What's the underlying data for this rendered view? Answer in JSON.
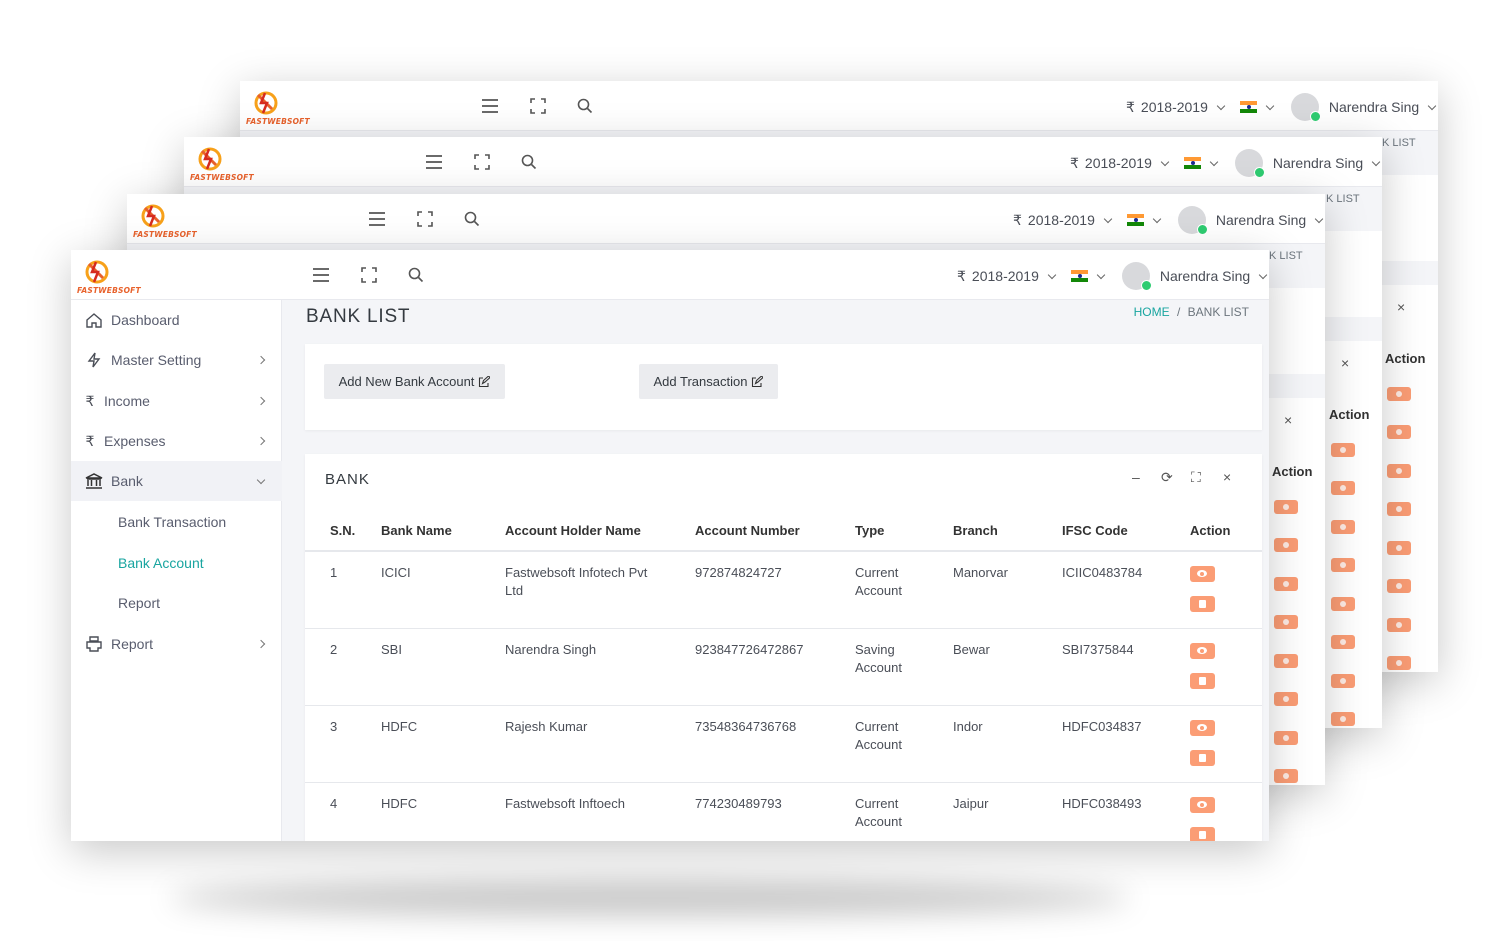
{
  "brand": {
    "logo_text": "FASTWEBSOFT"
  },
  "topbar": {
    "menu_icon": "hamburger-icon",
    "fullscreen_icon": "fullscreen-icon",
    "search_icon": "search-icon",
    "currency_symbol": "₹",
    "financial_year": "2018-2019",
    "language_flag": "india-flag-icon",
    "user_name": "Narendra Sing"
  },
  "sidebar": {
    "items": [
      {
        "label": "Dashboard",
        "icon": "home-icon"
      },
      {
        "label": "Master Setting",
        "icon": "bolt-icon"
      },
      {
        "label": "Income",
        "icon": "rupee-icon",
        "icon_glyph": "₹"
      },
      {
        "label": "Expenses",
        "icon": "rupee-icon",
        "icon_glyph": "₹"
      },
      {
        "label": "Bank",
        "icon": "bank-icon"
      },
      {
        "label": "Report",
        "icon": "printer-icon"
      }
    ],
    "bank_sub": [
      {
        "label": "Bank Transaction"
      },
      {
        "label": "Bank Account"
      },
      {
        "label": "Report"
      }
    ]
  },
  "page": {
    "title": "BANK LIST",
    "breadcrumb_home": "HOME",
    "breadcrumb_sep": "/",
    "breadcrumb_current": "BANK LIST",
    "back_breadcrumb_fragment": "K LIST"
  },
  "actions": {
    "add_bank": "Add New Bank Account",
    "add_transaction": "Add Transaction"
  },
  "bank_card": {
    "title": "BANK",
    "tools": {
      "minimize": "–",
      "refresh": "⟳",
      "expand": "⛶",
      "close": "×"
    },
    "columns": [
      "S.N.",
      "Bank Name",
      "Account Holder Name",
      "Account Number",
      "Type",
      "Branch",
      "IFSC Code",
      "Action"
    ],
    "rows": [
      {
        "sn": "1",
        "bank": "ICICI",
        "holder": "Fastwebsoft Infotech Pvt Ltd",
        "account": "972874824727",
        "type": "Current Account",
        "branch": "Manorvar",
        "ifsc": "ICIIC0483784"
      },
      {
        "sn": "2",
        "bank": "SBI",
        "holder": "Narendra Singh",
        "account": "923847726472867",
        "type": "Saving Account",
        "branch": "Bewar",
        "ifsc": "SBI7375844"
      },
      {
        "sn": "3",
        "bank": "HDFC",
        "holder": "Rajesh Kumar",
        "account": "73548364736768",
        "type": "Current Account",
        "branch": "Indor",
        "ifsc": "HDFC034837"
      },
      {
        "sn": "4",
        "bank": "HDFC",
        "holder": "Fastwebsoft Inftoech",
        "account": "774230489793",
        "type": "Current Account",
        "branch": "Jaipur",
        "ifsc": "HDFC038493"
      }
    ]
  },
  "colors": {
    "accent_teal": "#19a5a0",
    "action_orange": "#fb9d75",
    "online_green": "#2ecc71",
    "brand_orange": "#e8612b"
  }
}
